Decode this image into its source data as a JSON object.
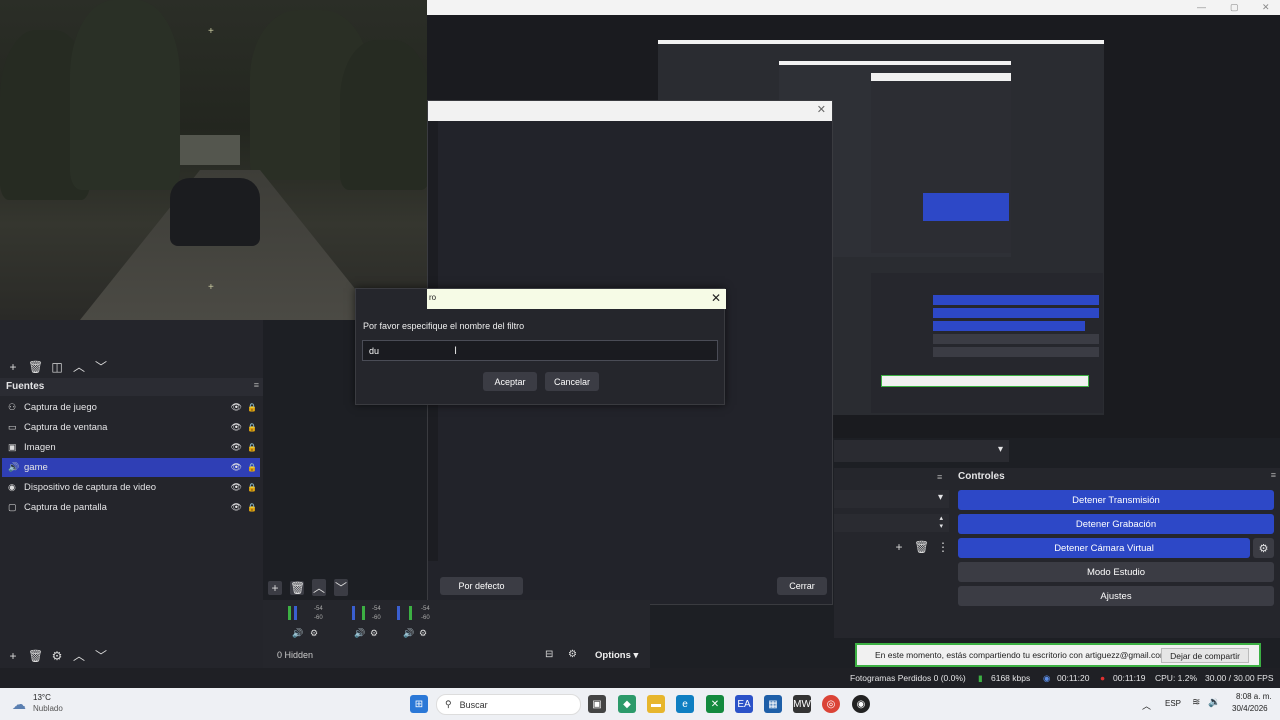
{
  "dialog": {
    "title_fragment": "ro",
    "label": "Por favor especifique el nombre del filtro",
    "input_value": "du",
    "accept": "Aceptar",
    "cancel": "Cancelar"
  },
  "filter_window": {
    "defaults": "Por defecto",
    "close": "Cerrar"
  },
  "sources": {
    "title": "Fuentes",
    "items": [
      {
        "label": "Captura de juego",
        "icon": "gamepad-icon"
      },
      {
        "label": "Captura de ventana",
        "icon": "window-icon"
      },
      {
        "label": "Imagen",
        "icon": "image-icon"
      },
      {
        "label": "game",
        "icon": "speaker-icon",
        "selected": true
      },
      {
        "label": "Dispositivo de captura de video",
        "icon": "camera-icon"
      },
      {
        "label": "Captura de pantalla",
        "icon": "monitor-icon"
      }
    ]
  },
  "mixer": {
    "hidden_label": "0 Hidden",
    "options": "Options",
    "meter_ticks": [
      "-54",
      "-60"
    ]
  },
  "controls": {
    "title": "Controles",
    "stop_stream": "Detener Transmisión",
    "stop_recording": "Detener Grabación",
    "stop_vcam": "Detener Cámara Virtual",
    "studio_mode": "Modo Estudio",
    "settings": "Ajustes"
  },
  "share_bar": {
    "text": "En este momento, estás compartiendo tu escritorio con artiguezz@gmail.com",
    "stop": "Dejar de compartir"
  },
  "status": {
    "dropped": "Fotogramas Perdidos 0 (0.0%)",
    "bitrate": "6168 kbps",
    "stream_time": "00:11:20",
    "rec_time": "00:11:19",
    "cpu": "CPU: 1.2%",
    "fps": "30.00 / 30.00 FPS"
  },
  "taskbar": {
    "temp": "13°C",
    "weather": "Nublado",
    "search": "Buscar",
    "lang": "ESP",
    "time": "8:08 a. m.",
    "date": "30/4/2026"
  },
  "colors": {
    "accent": "#2d48c7",
    "share_green": "#3cb043"
  }
}
